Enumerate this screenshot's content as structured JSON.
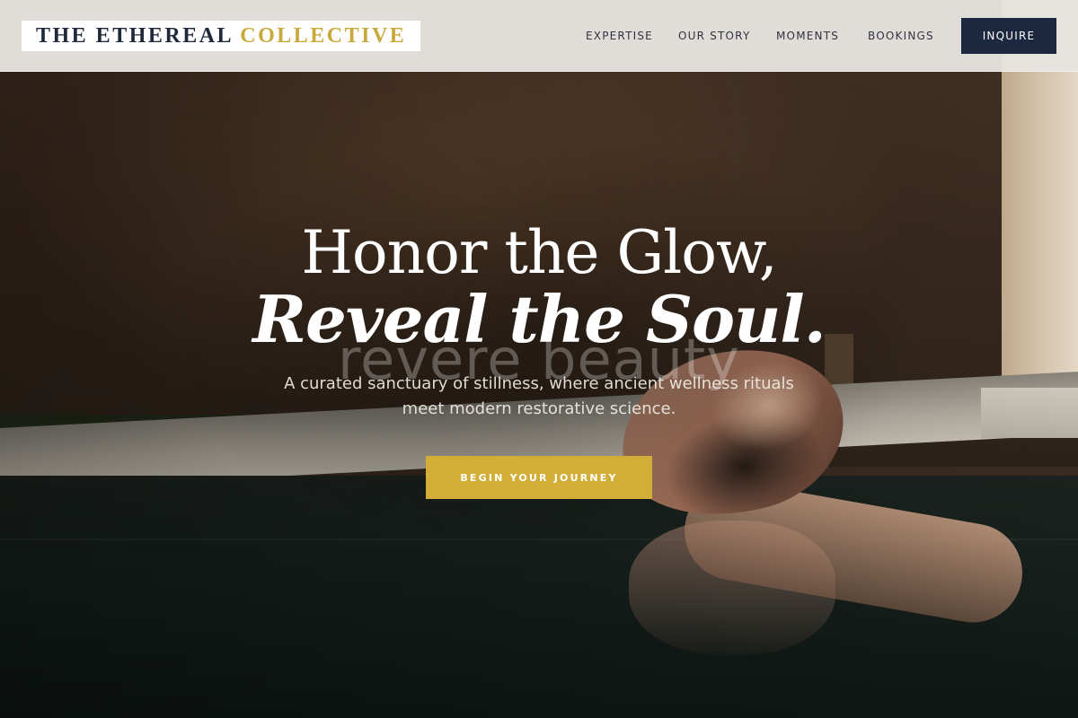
{
  "brand": {
    "name_part1": "THE ETHEREAL",
    "name_part2": "COLLECTIVE",
    "accent_color": "#c9a93a",
    "primary_color": "#1c2740"
  },
  "nav": {
    "items": [
      {
        "label": "EXPERTISE"
      },
      {
        "label": "OUR STORY"
      },
      {
        "label": "MOMENTS"
      },
      {
        "label": "BOOKINGS"
      }
    ],
    "cta_label": "INQUIRE"
  },
  "hero": {
    "headline_line1": "Honor the Glow,",
    "headline_line2": "Reveal the Soul.",
    "ghost_text": "revere beauty",
    "subtitle": "A curated sanctuary of stillness, where ancient wellness rituals meet modern restorative science.",
    "cta_label": "BEGIN YOUR JOURNEY",
    "cta_color": "#d2ad37"
  }
}
